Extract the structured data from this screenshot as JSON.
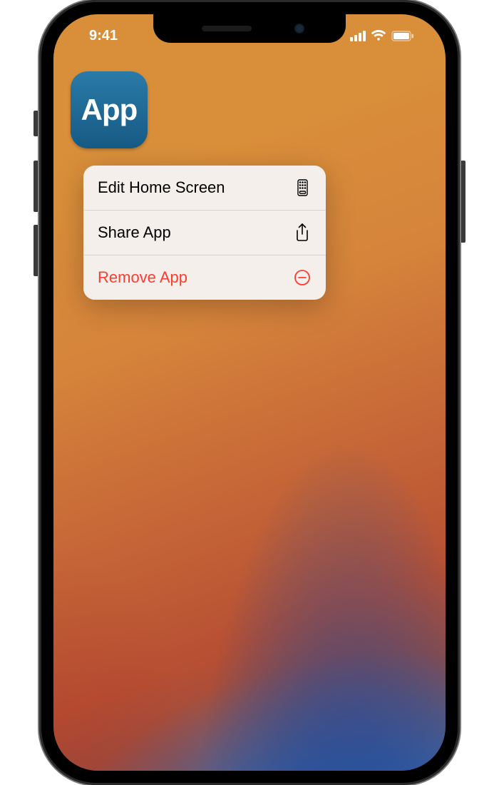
{
  "status": {
    "time": "9:41"
  },
  "app": {
    "label": "App"
  },
  "menu": {
    "items": [
      {
        "label": "Edit Home Screen",
        "icon": "device-icon",
        "destructive": false
      },
      {
        "label": "Share App",
        "icon": "share-icon",
        "destructive": false
      },
      {
        "label": "Remove App",
        "icon": "minus-circle-icon",
        "destructive": true
      }
    ]
  },
  "colors": {
    "destructive": "#ff3b30"
  }
}
